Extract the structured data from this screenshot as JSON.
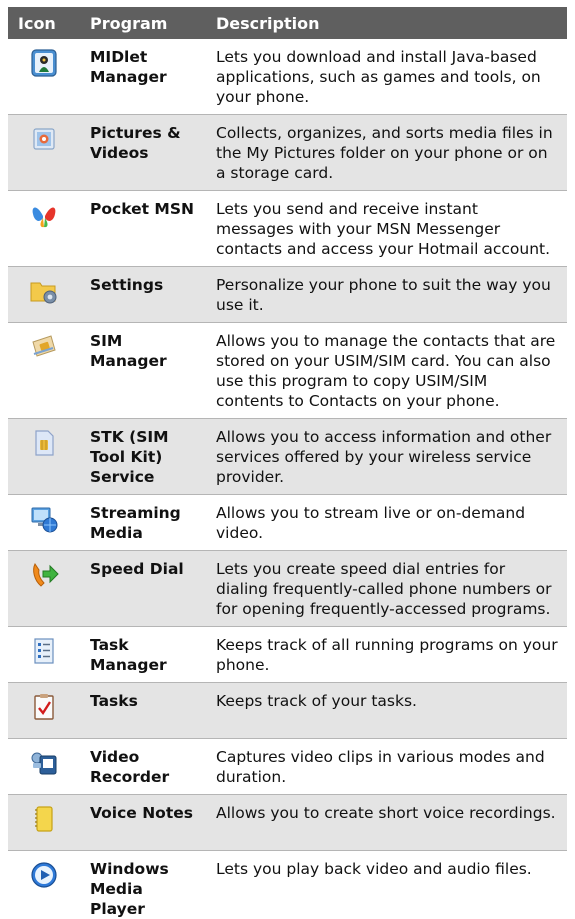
{
  "headers": {
    "icon": "Icon",
    "program": "Program",
    "description": "Description"
  },
  "rows": [
    {
      "program": "MIDlet Manager",
      "description": "Lets you download and install Java-based applications, such as games and tools, on your phone.",
      "icon": "midlet-manager-icon"
    },
    {
      "program": "Pictures & Videos",
      "description": "Collects, organizes, and sorts media files in the My Pictures folder on your phone or on a storage card.",
      "icon": "pictures-videos-icon"
    },
    {
      "program": "Pocket MSN",
      "description": "Lets you send and receive instant messages with your MSN Messenger contacts and access your Hotmail account.",
      "icon": "msn-butterfly-icon"
    },
    {
      "program": "Settings",
      "description": "Personalize your phone to suit the way you use it.",
      "icon": "settings-folder-icon"
    },
    {
      "program": "SIM Manager",
      "description": "Allows you to manage the contacts that are stored on your USIM/SIM card. You can also use this program to copy USIM/SIM contents to Contacts on your phone.",
      "icon": "sim-manager-icon"
    },
    {
      "program": "STK (SIM Tool Kit) Service",
      "description": "Allows you to access information and other services offered by your wireless service provider.",
      "icon": "sim-card-icon"
    },
    {
      "program": "Streaming Media",
      "description": "Allows you to stream live or on-demand video.",
      "icon": "streaming-media-icon"
    },
    {
      "program": "Speed Dial",
      "description": "Lets you create speed dial entries for dialing frequently-called phone numbers or for opening frequently-accessed programs.",
      "icon": "speed-dial-icon"
    },
    {
      "program": "Task Manager",
      "description": "Keeps track of all running programs on your phone.",
      "icon": "task-manager-icon"
    },
    {
      "program": "Tasks",
      "description": "Keeps track of your tasks.",
      "icon": "tasks-checklist-icon"
    },
    {
      "program": "Video Recorder",
      "description": "Captures video clips in various modes and duration.",
      "icon": "video-recorder-icon"
    },
    {
      "program": "Voice Notes",
      "description": "Allows you to create short voice recordings.",
      "icon": "voice-notes-icon"
    },
    {
      "program": "Windows Media Player",
      "description": "Lets you play back video and audio files.",
      "icon": "media-player-icon"
    }
  ]
}
